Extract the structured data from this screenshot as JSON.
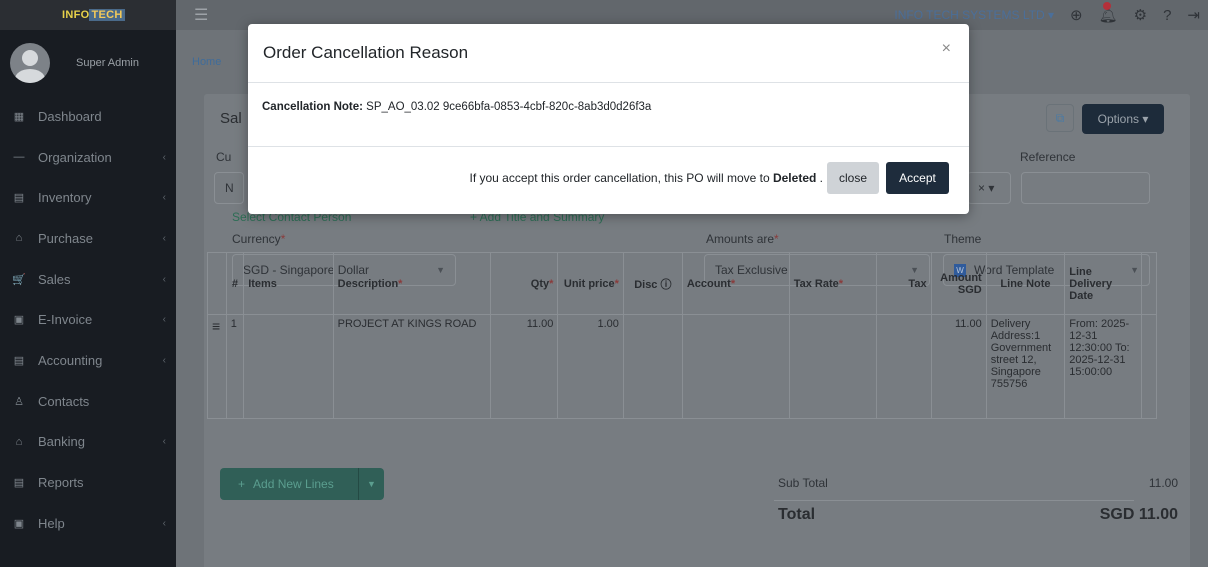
{
  "app": {
    "logo_left": "INFO",
    "logo_right": "TECH",
    "user_name": "Super Admin",
    "company": "INFO TECH SYSTEMS LTD ▾"
  },
  "sidebar": {
    "items": [
      {
        "label": "Dashboard",
        "icon": "dashboard-icon",
        "glyph": "▦",
        "chevron": ""
      },
      {
        "label": "Organization",
        "icon": "organization-icon",
        "glyph": "—",
        "chevron": "‹"
      },
      {
        "label": "Inventory",
        "icon": "inventory-icon",
        "glyph": "▤",
        "chevron": "‹"
      },
      {
        "label": "Purchase",
        "icon": "purchase-icon",
        "glyph": "⌂",
        "chevron": "‹"
      },
      {
        "label": "Sales",
        "icon": "sales-icon",
        "glyph": "🛒",
        "chevron": "‹"
      },
      {
        "label": "E-Invoice",
        "icon": "einvoice-icon",
        "glyph": "▣",
        "chevron": "‹"
      },
      {
        "label": "Accounting",
        "icon": "accounting-icon",
        "glyph": "▤",
        "chevron": "‹"
      },
      {
        "label": "Contacts",
        "icon": "contacts-icon",
        "glyph": "♙",
        "chevron": ""
      },
      {
        "label": "Banking",
        "icon": "banking-icon",
        "glyph": "⌂",
        "chevron": "‹"
      },
      {
        "label": "Reports",
        "icon": "reports-icon",
        "glyph": "▤",
        "chevron": ""
      },
      {
        "label": "Help",
        "icon": "help-icon",
        "glyph": "▣",
        "chevron": "‹"
      }
    ]
  },
  "page": {
    "breadcrumb": "Home",
    "title": "Sal",
    "options_label": "Options ▾",
    "customer_label": "Cu",
    "customer_value": "N",
    "reference_label": "Reference",
    "x_select": "× ▾",
    "select_contact_link": "Select Contact Person",
    "add_title_link": "+ Add Title and Summary",
    "currency_label": "Currency",
    "currency_value": "SGD - Singapore Dollar",
    "amounts_label": "Amounts are",
    "amounts_value": "Tax Exclusive",
    "theme_label": "Theme",
    "theme_value": "Word Template"
  },
  "table": {
    "headers": {
      "num": "#",
      "items": "Items",
      "description": "Description",
      "qty": "Qty",
      "unit_price": "Unit price",
      "disc": "Disc",
      "account": "Account",
      "tax_rate": "Tax Rate",
      "tax": "Tax",
      "amount": "Amount SGD",
      "line_note": "Line Note",
      "delivery": "Line Delivery Date"
    },
    "row": {
      "num": "1",
      "items": "",
      "description": "PROJECT AT KINGS ROAD",
      "qty": "11.00",
      "unit_price": "1.00",
      "disc": "",
      "account": "",
      "tax_rate": "",
      "tax": "",
      "amount": "11.00",
      "line_note": "Delivery Address:1 Government street 12, Singapore 755756",
      "delivery": "From: 2025-12-31 12:30:00 To: 2025-12-31 15:00:00"
    }
  },
  "footer": {
    "add_lines_label": "Add New Lines",
    "subtotal_label": "Sub Total",
    "subtotal_value": "11.00",
    "total_label": "Total",
    "total_value": "SGD 11.00"
  },
  "modal": {
    "title": "Order Cancellation Reason",
    "note_label": "Cancellation Note:",
    "note_value": " SP_AO_03.02 9ce66bfa-0853-4cbf-820c-8ab3d0d26f3a",
    "message_prefix": "If you accept this order cancellation, this PO will move to ",
    "message_status": "Deleted",
    "message_suffix": " .",
    "close_label": "close",
    "accept_label": "Accept"
  }
}
